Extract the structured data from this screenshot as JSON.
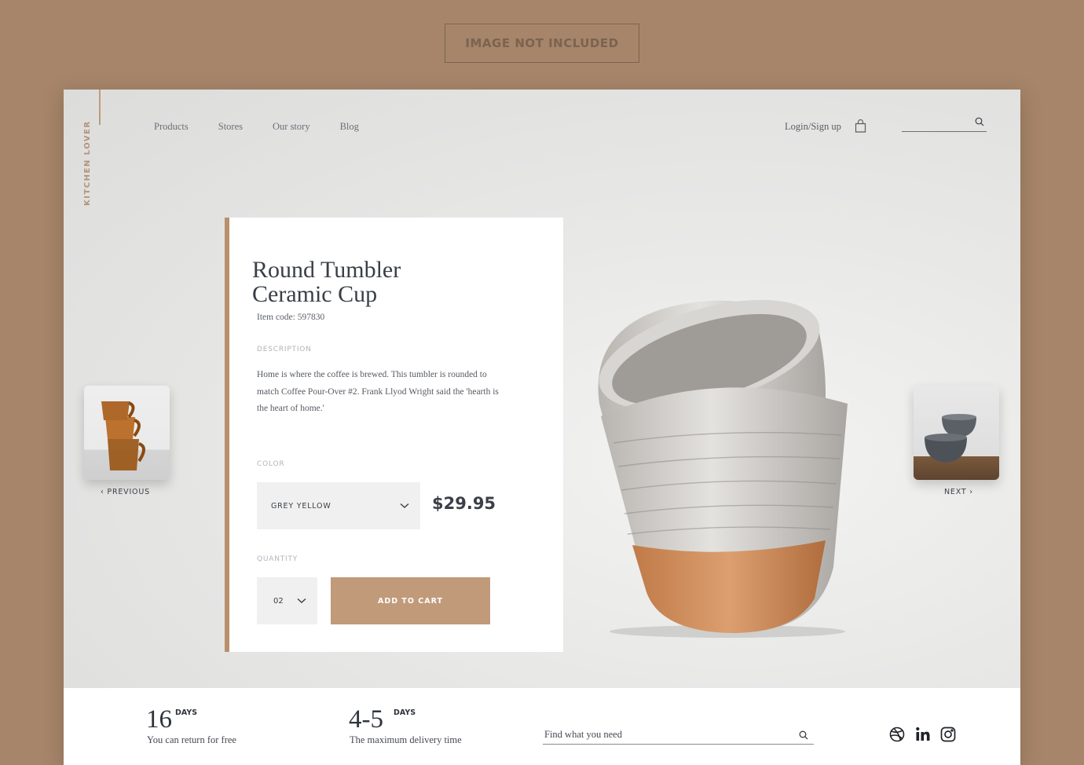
{
  "banner": {
    "text": "IMAGE NOT INCLUDED"
  },
  "brand": "KITCHEN LOVER",
  "nav": {
    "items": [
      "Products",
      "Stores",
      "Our story",
      "Blog"
    ],
    "login_label": "Login/Sign up",
    "cart_icon": "shopping-bag-icon",
    "search_icon": "search-icon"
  },
  "product": {
    "title_line1": "Round Tumbler",
    "title_line2": "Ceramic Cup",
    "item_code": "Item code: 597830",
    "description_label": "DESCRIPTION",
    "description": "Home is where the coffee is brewed. This tumbler is rounded to match Coffee Pour-Over #2. Frank Llyod Wright said the 'hearth is the heart of home.'",
    "color_label": "COLOR",
    "color_value": "GREY YELLOW",
    "price": "$29.95",
    "quantity_label": "QUANTITY",
    "quantity_value": "02",
    "add_to_cart": "ADD TO CART"
  },
  "carousel": {
    "previous": "PREVIOUS",
    "next": "NEXT"
  },
  "footer": {
    "return_days": "16",
    "return_unit": "DAYS",
    "return_text": "You can return for free",
    "delivery_days": "4-5",
    "delivery_unit": "DAYS",
    "delivery_text": "The maximum delivery time",
    "search_placeholder": "Find what you need",
    "social_icons": [
      "dribbble-icon",
      "linkedin-icon",
      "instagram-icon"
    ]
  },
  "colors": {
    "background": "#a6856a",
    "accent": "#c19a7a",
    "text_dark": "#3a3f47"
  }
}
